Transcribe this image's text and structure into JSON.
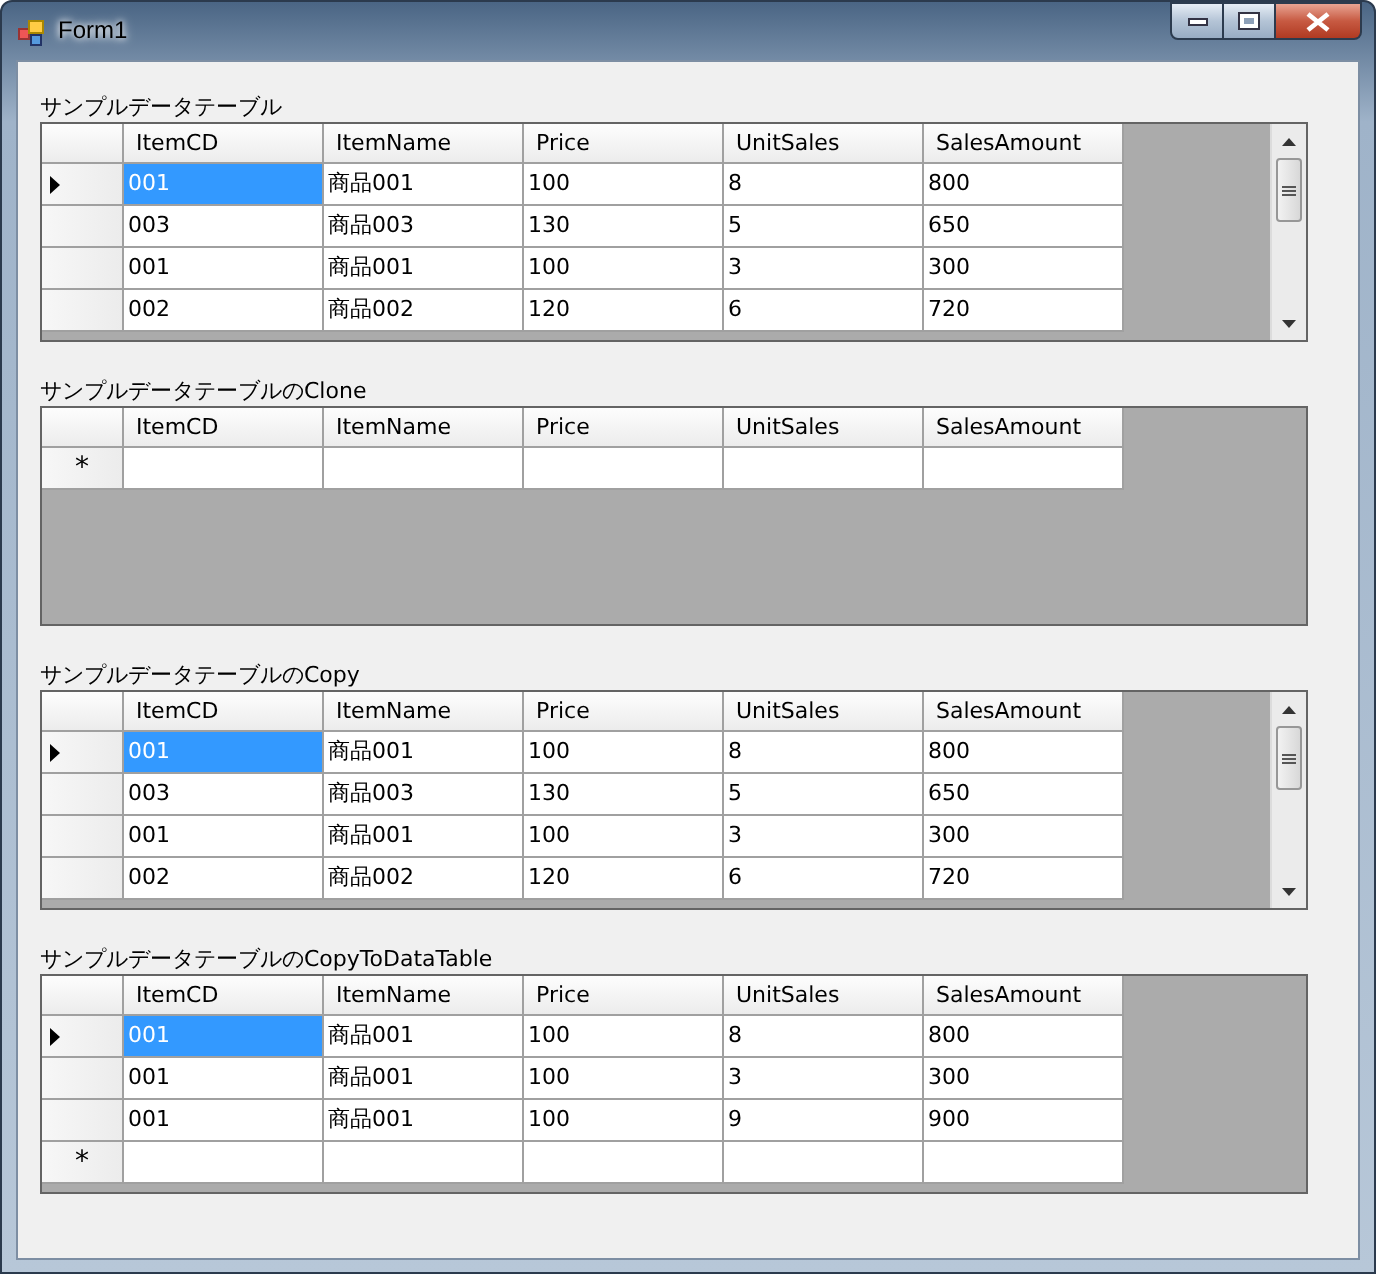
{
  "window": {
    "title": "Form1"
  },
  "grids": [
    {
      "caption": "サンプルデータテーブル",
      "scrollbar": true,
      "columns": [
        "ItemCD",
        "ItemName",
        "Price",
        "UnitSales",
        "SalesAmount"
      ],
      "rows": [
        {
          "selected": true,
          "cells": [
            "001",
            "商品001",
            "100",
            "8",
            "800"
          ]
        },
        {
          "selected": false,
          "cells": [
            "003",
            "商品003",
            "130",
            "5",
            "650"
          ]
        },
        {
          "selected": false,
          "cells": [
            "001",
            "商品001",
            "100",
            "3",
            "300"
          ]
        },
        {
          "selected": false,
          "cells": [
            "002",
            "商品002",
            "120",
            "6",
            "720"
          ]
        }
      ]
    },
    {
      "caption": "サンプルデータテーブルのClone",
      "scrollbar": false,
      "columns": [
        "ItemCD",
        "ItemName",
        "Price",
        "UnitSales",
        "SalesAmount"
      ],
      "new_row_marker": "*"
    },
    {
      "caption": "サンプルデータテーブルのCopy",
      "scrollbar": true,
      "columns": [
        "ItemCD",
        "ItemName",
        "Price",
        "UnitSales",
        "SalesAmount"
      ],
      "rows": [
        {
          "selected": true,
          "cells": [
            "001",
            "商品001",
            "100",
            "8",
            "800"
          ]
        },
        {
          "selected": false,
          "cells": [
            "003",
            "商品003",
            "130",
            "5",
            "650"
          ]
        },
        {
          "selected": false,
          "cells": [
            "001",
            "商品001",
            "100",
            "3",
            "300"
          ]
        },
        {
          "selected": false,
          "cells": [
            "002",
            "商品002",
            "120",
            "6",
            "720"
          ]
        }
      ]
    },
    {
      "caption": "サンプルデータテーブルのCopyToDataTable",
      "scrollbar": false,
      "columns": [
        "ItemCD",
        "ItemName",
        "Price",
        "UnitSales",
        "SalesAmount"
      ],
      "rows": [
        {
          "selected": true,
          "cells": [
            "001",
            "商品001",
            "100",
            "8",
            "800"
          ]
        },
        {
          "selected": false,
          "cells": [
            "001",
            "商品001",
            "100",
            "3",
            "300"
          ]
        },
        {
          "selected": false,
          "cells": [
            "001",
            "商品001",
            "100",
            "9",
            "900"
          ]
        }
      ],
      "new_row_marker": "*"
    }
  ]
}
